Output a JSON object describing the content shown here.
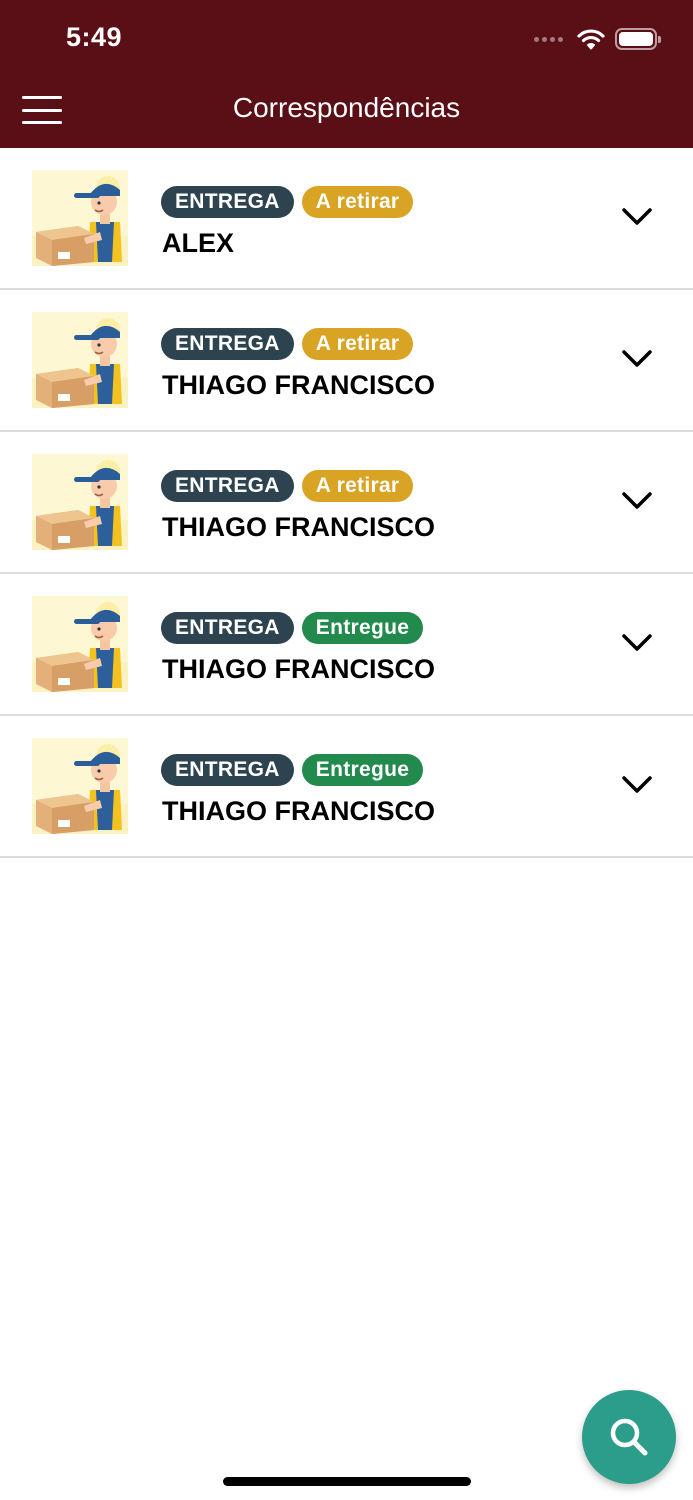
{
  "status_bar": {
    "time": "5:49"
  },
  "header": {
    "title": "Correspondências",
    "background": "#5a0e15"
  },
  "icons": {
    "menu": "hamburger-icon",
    "expand": "chevron-down-icon",
    "search": "search-icon",
    "avatar": "delivery-person-icon"
  },
  "colors": {
    "type_badge": "#2d4350",
    "status_pending": "#d9a423",
    "status_delivered": "#228a4d",
    "fab": "#2c9d8a"
  },
  "items": [
    {
      "type": "ENTREGA",
      "status": "A retirar",
      "status_color": "#d9a423",
      "name": "ALEX"
    },
    {
      "type": "ENTREGA",
      "status": "A retirar",
      "status_color": "#d9a423",
      "name": "THIAGO FRANCISCO"
    },
    {
      "type": "ENTREGA",
      "status": "A retirar",
      "status_color": "#d9a423",
      "name": "THIAGO FRANCISCO"
    },
    {
      "type": "ENTREGA",
      "status": "Entregue",
      "status_color": "#228a4d",
      "name": "THIAGO FRANCISCO"
    },
    {
      "type": "ENTREGA",
      "status": "Entregue",
      "status_color": "#228a4d",
      "name": "THIAGO FRANCISCO"
    }
  ]
}
